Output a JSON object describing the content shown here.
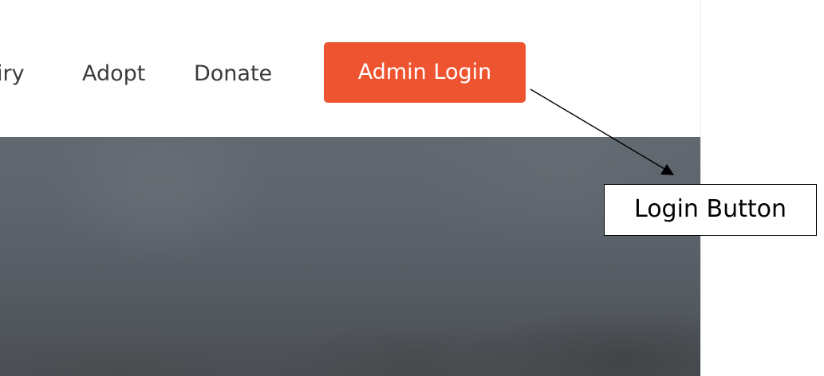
{
  "nav": {
    "links": [
      {
        "label": "iry"
      },
      {
        "label": "Adopt"
      },
      {
        "label": "Donate"
      }
    ],
    "admin_login_label": "Admin Login"
  },
  "annotation": {
    "label": "Login Button"
  },
  "colors": {
    "accent": "#ee5430",
    "nav_text": "#3b3b3b",
    "hero": "#5c636b"
  }
}
